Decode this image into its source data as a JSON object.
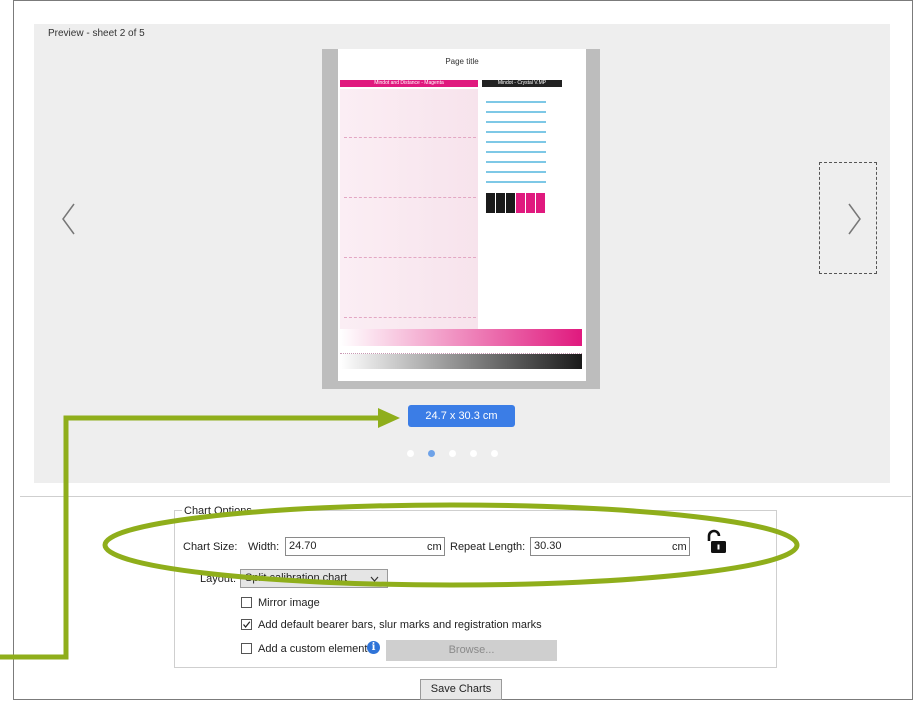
{
  "preview": {
    "label": "Preview - sheet 2 of 5",
    "size_button": "24.7 x 30.3 cm",
    "page_count": 5,
    "active_page": 2
  },
  "sheet": {
    "title": "Page title",
    "magenta_header": "Mindot and Distance - Magenta",
    "dark_header": "Mindot - Crystal V.MP"
  },
  "chart_options": {
    "title": "Chart Options",
    "chart_size_label": "Chart Size:",
    "width_label": "Width:",
    "width_value": "24.70",
    "width_unit": "cm",
    "repeat_length_label": "Repeat Length:",
    "repeat_length_value": "30.30",
    "repeat_length_unit": "cm",
    "layout_label": "Layout:",
    "layout_value": "Split calibration chart",
    "mirror_image_label": "Mirror image",
    "mirror_image_checked": false,
    "default_marks_label": "Add default bearer bars, slur marks and registration marks",
    "default_marks_checked": true,
    "custom_element_label": "Add a custom element",
    "custom_element_checked": false,
    "browse_label": "Browse..."
  },
  "save_button": "Save Charts",
  "colors": {
    "accent_blue": "#3b7de6",
    "magenta": "#e0197e",
    "annotation_green": "#8fae1b"
  }
}
